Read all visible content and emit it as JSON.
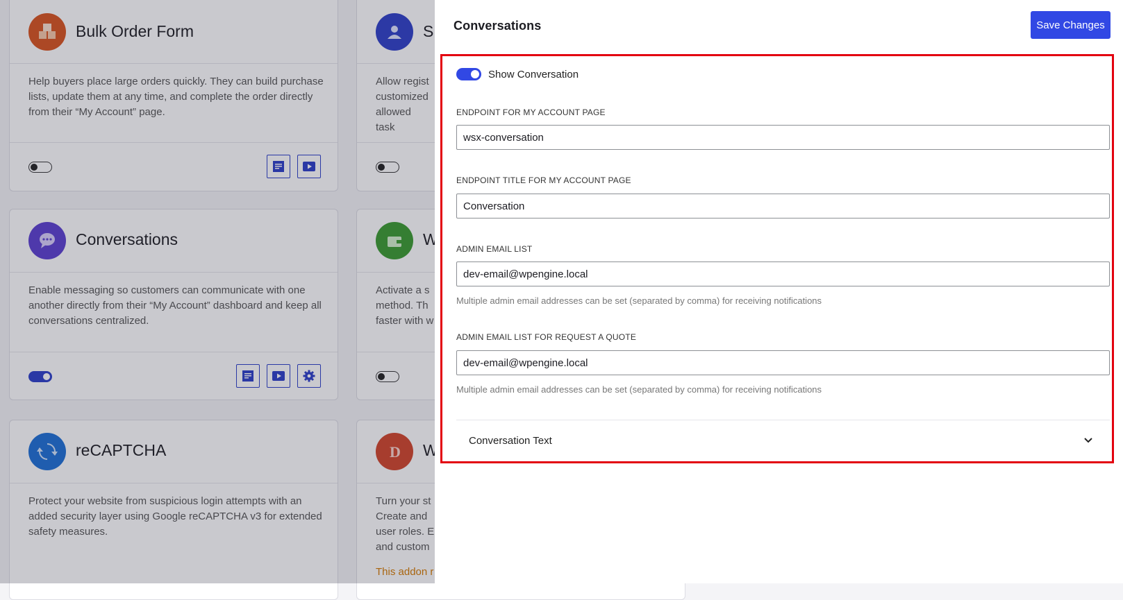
{
  "background_cards": {
    "bulk_order": {
      "title": "Bulk Order Form",
      "description": "Help buyers place large orders quickly. They can build purchase lists, update them at any time, and complete the order directly from their “My Account” page.",
      "icon": "boxes-icon",
      "color": "#d9531e"
    },
    "conversations": {
      "title": "Conversations",
      "description": "Enable messaging so customers can communicate with one another directly from their “My Account” dashboard and keep all conversations centralized.",
      "icon": "chat-bubble-icon",
      "color": "#5b3fd0"
    },
    "recaptcha": {
      "title": "reCAPTCHA",
      "description": "Protect your website from suspicious login attempts with an added security layer using Google reCAPTCHA v3 for extended safety measures.",
      "icon": "recaptcha-icon",
      "color": "#1d6fd6"
    },
    "subaccounts": {
      "title": "S",
      "description": "Allow regist customized allowed task",
      "icon": "users-icon",
      "color": "#2e3fc8"
    },
    "wallet": {
      "title": "W",
      "description": "Activate a s method. Th faster with w",
      "icon": "wallet-icon",
      "color": "#3a9b2f"
    },
    "dokan": {
      "title": "W",
      "description": "Turn your st Create and user roles. E and custom",
      "warning": "This addon r",
      "icon": "dokan-icon",
      "color": "#d2442a"
    }
  },
  "drawer": {
    "title": "Conversations",
    "save_label": "Save Changes",
    "show_conversation_label": "Show Conversation",
    "show_conversation_on": true,
    "fields": {
      "endpoint_label": "ENDPOINT FOR MY ACCOUNT PAGE",
      "endpoint_value": "wsx-conversation",
      "endpoint_title_label": "ENDPOINT TITLE FOR MY ACCOUNT PAGE",
      "endpoint_title_value": "Conversation",
      "admin_email_label": "ADMIN EMAIL LIST",
      "admin_email_value": "dev-email@wpengine.local",
      "admin_email_help": "Multiple admin email addresses can be set (separated by comma) for receiving notifications",
      "quote_email_label": "ADMIN EMAIL LIST FOR REQUEST A QUOTE",
      "quote_email_value": "dev-email@wpengine.local",
      "quote_email_help": "Multiple admin email addresses can be set (separated by comma) for receiving notifications"
    },
    "accordion_label": "Conversation Text"
  },
  "colors": {
    "accent": "#3148e4",
    "highlight": "#e3000f"
  }
}
